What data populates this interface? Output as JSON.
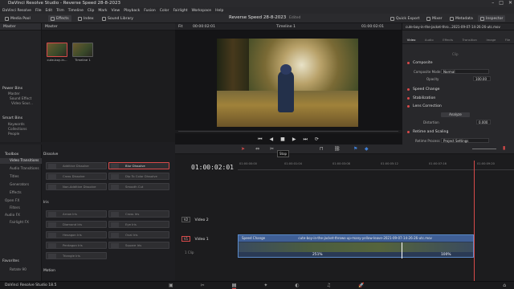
{
  "titlebar": {
    "title": "DaVinci Resolve Studio - Reverse Speed 28-8-2023"
  },
  "menu": [
    "DaVinci Resolve",
    "File",
    "Edit",
    "Trim",
    "Timeline",
    "Clip",
    "Mark",
    "View",
    "Playback",
    "Fusion",
    "Color",
    "Fairlight",
    "Workspace",
    "Help"
  ],
  "toolbar": {
    "media_pool": "Media Pool",
    "effects": "Effects",
    "index": "Index",
    "sound_library": "Sound Library",
    "project_name": "Reverse Speed 28-8-2023",
    "edited": "Edited",
    "quick_export": "Quick Export",
    "mixer": "Mixer",
    "metadata": "Metadata",
    "inspector": "Inspector"
  },
  "media_pool": {
    "bins_root": "Master",
    "header": "Master",
    "power_bins": "Power Bins",
    "power_items": [
      "Master",
      "Sound Effect",
      "Video Sour..."
    ],
    "smart_bins": "Smart Bins",
    "smart_items": [
      "Keywords",
      "Collections",
      "People"
    ],
    "clips": [
      {
        "label": "cute-boy-in..."
      },
      {
        "label": "Timeline 1"
      }
    ]
  },
  "viewer": {
    "fit": "Fit",
    "timecode_left": "00:00:02:01",
    "timeline_name": "Timeline 1",
    "timecode_right": "01:00:02:01"
  },
  "inspector": {
    "clip_name": "cute-boy-in-the-jacket-thro...2021-09-07-14-26-26-utc.mov",
    "tabs": [
      "Video",
      "Audio",
      "Effects",
      "Transition",
      "Image",
      "File"
    ],
    "subtab": "Clip",
    "composite": "Composite",
    "composite_mode_label": "Composite Mode",
    "composite_mode_value": "Normal",
    "opacity_label": "Opacity",
    "opacity_value": "100.00",
    "speed_change": "Speed Change",
    "stabilization": "Stabilization",
    "lens_correction": "Lens Correction",
    "analyze": "Analyze",
    "distortion_label": "Distortion",
    "distortion_value": "0.000",
    "retime_scaling": "Retime and Scaling",
    "retime_process_label": "Retime Process",
    "retime_process_value": "Project Settings"
  },
  "effects": {
    "toolbox": "Toolbox",
    "left_items": [
      "Video Transitions",
      "Audio Transitions",
      "Titles",
      "Generators",
      "Effects",
      "Open FX",
      "Filters",
      "Audio FX",
      "Fairlight FX"
    ],
    "favorites": "Favorites",
    "fav_item": "Rotate 90",
    "dissolve_header": "Dissolve",
    "dissolve": [
      "Additive Dissolve",
      "Blur Dissolve",
      "Cross Dissolve",
      "Dip To Color Dissolve",
      "Non-Additive Dissolve",
      "Smooth Cut"
    ],
    "iris_header": "Iris",
    "iris": [
      "Arrow Iris",
      "Cross Iris",
      "Diamond Iris",
      "Eye Iris",
      "Hexagon Iris",
      "Oval Iris",
      "Pentagon Iris",
      "Square Iris",
      "Triangle Iris"
    ],
    "motion_header": "Motion"
  },
  "timeline": {
    "timecode": "01:00:02:01",
    "tooltip": "Stop",
    "ruler": [
      "01:00:00:00",
      "01:00:01:04",
      "01:00:03:08",
      "01:00:05:12",
      "01:00:07:16",
      "01:00:09:20"
    ],
    "v2": "V2",
    "v2_name": "Video 2",
    "v1": "V1",
    "v1_name": "Video 1",
    "clip_count": "1 Clip",
    "clip_header": "Speed Change",
    "clip_name": "cute-boy-in-the-jacket-throws-up-many-yellow-leave-2021-09-07-14-26-26-utc.mov",
    "speed_left": "251%",
    "speed_right": "100%"
  },
  "bottombar": {
    "app": "DaVinci Resolve Studio 18.5"
  },
  "pages": [
    "media-icon",
    "cut-icon",
    "edit-icon",
    "fusion-icon",
    "color-icon",
    "fairlight-icon",
    "deliver-icon"
  ],
  "colors": {
    "accent": "#d74a4a",
    "clip_blue": "#3f5f96"
  }
}
